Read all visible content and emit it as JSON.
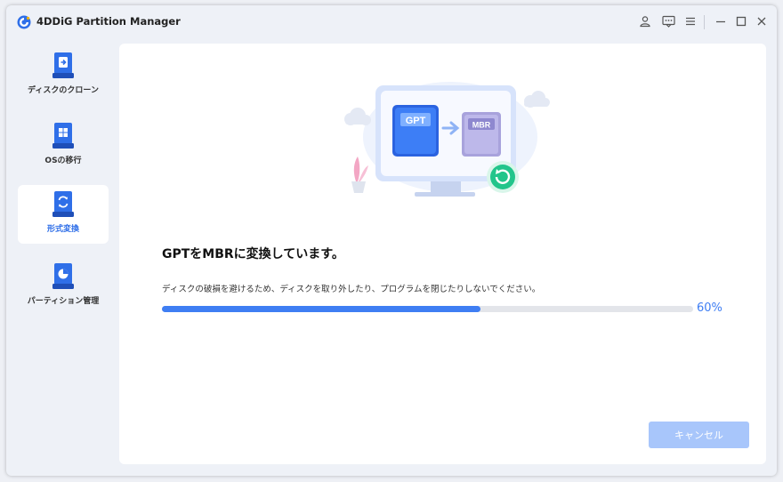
{
  "app": {
    "title": "4DDiG Partition Manager"
  },
  "titlebar": {
    "icons": [
      "user-icon",
      "feedback-icon",
      "menu-icon",
      "minimize-icon",
      "maximize-icon",
      "close-icon"
    ]
  },
  "sidebar": {
    "items": [
      {
        "label": "ディスクのクローン",
        "icon": "disk-clone-icon",
        "active": false
      },
      {
        "label": "OSの移行",
        "icon": "os-migrate-icon",
        "active": false
      },
      {
        "label": "形式変換",
        "icon": "format-convert-icon",
        "active": true
      },
      {
        "label": "パーティション管理",
        "icon": "partition-manage-icon",
        "active": false
      }
    ]
  },
  "main": {
    "illustration": {
      "from_label": "GPT",
      "to_label": "MBR"
    },
    "title": "GPTをMBRに変換しています。",
    "description": "ディスクの破損を避けるため、ディスクを取り外したり、プログラムを閉じたりしないでください。",
    "progress": {
      "value": 0.6,
      "label": "60%"
    },
    "cancel_label": "キャンセル"
  },
  "colors": {
    "accent": "#3f7ef3",
    "progress_track": "#e3e5ea",
    "cancel_disabled": "#a8c6fb",
    "sidebar_bg": "#eef1f7",
    "success_green": "#22c58b"
  }
}
